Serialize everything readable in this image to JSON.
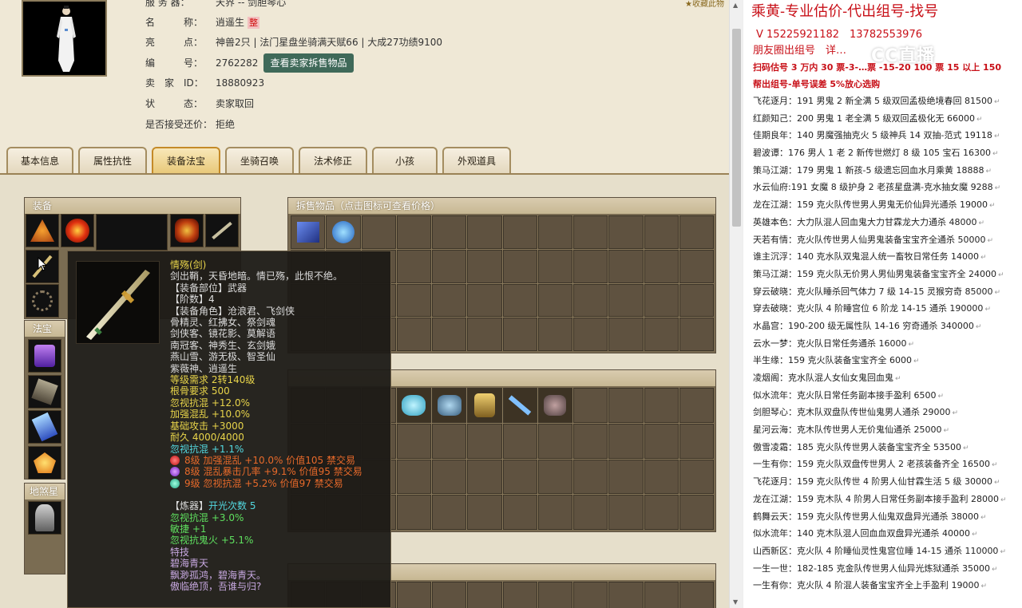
{
  "info": {
    "server_label": "服 务 器：",
    "server_value": "天界 -- 剑胆琴心",
    "name_label": "名　　　称：",
    "name_value": "逍遥生",
    "name_badge": "整",
    "highlight_label": "亮　　　点：",
    "highlight_value": "神兽2只 | 法门星盘坐骑满天赋66 | 大成27功绩9100",
    "id_label": "编　　　号：",
    "id_value": "2762282",
    "view_items_button": "查看卖家拆售物品",
    "seller_label": "卖　家　ID：",
    "seller_value": "18880923",
    "status_label": "状　　　态：",
    "status_value": "卖家取回",
    "bargain_label": "是否接受还价：",
    "bargain_value": "拒绝",
    "favorite": "收藏此物"
  },
  "tabs": [
    {
      "label": "基本信息"
    },
    {
      "label": "属性抗性"
    },
    {
      "label": "装备法宝"
    },
    {
      "label": "坐骑召唤兽"
    },
    {
      "label": "法术修正"
    },
    {
      "label": "小孩"
    },
    {
      "label": "外观道具"
    }
  ],
  "active_tab": "装备法宝",
  "sections": {
    "equipment": "装备",
    "magic_treasure": "法宝",
    "earth_treasure": "地煞星",
    "sale_items": "拆售物品（点击图标可查看价格）"
  },
  "tooltip": {
    "name": "情殇(剑)",
    "desc": "剑出鞘，天昏地暗。情已殇，此恨不绝。",
    "part": "【装备部位】武器",
    "level": "【阶数】4",
    "roles_1": "【装备角色】沧浪君、飞剑侠",
    "roles_2": "骨精灵、红拂女、祭剑魂",
    "roles_3": "剑侠客、镜花影、莫解语",
    "roles_4": "南冠客、神秀生、玄剑娥",
    "roles_5": "燕山雪、游无极、智圣仙",
    "roles_6": "紫薇神、逍遥生",
    "req_level": "等级需求 2转140级",
    "req_bone": "根骨要求 500",
    "stat_1": "忽视抗混 +12.0%",
    "stat_2": "加强混乱 +10.0%",
    "stat_3": "基础攻击 +3000",
    "stat_4": "耐久 4000/4000",
    "stat_5": "忽视抗混 +1.1%",
    "gem_1": "8级 加强混乱 +10.0% 价值105 禁交易",
    "gem_2": "8级 混乱暴击几率 +9.1% 价值95 禁交易",
    "gem_3": "9级 忽视抗混 +5.2% 价值97 禁交易",
    "forge_title": "【炼器】",
    "forge_count": "开光次数 5",
    "forge_1": "忽视抗混 +3.0%",
    "forge_2": "敏捷 +1",
    "forge_3": "忽视抗鬼火 +5.1%",
    "skill_title": "特技",
    "skill_name": "碧海青天",
    "poem_1": "飘渺孤鸿，碧海青天。",
    "poem_2": "傲临绝顶，吾谁与归?"
  },
  "right": {
    "title": "乘黄-专业估价-代出组号-找号",
    "phone": "V 15225921182　13782553976",
    "friend": "朋友圈出组号　详…",
    "watermark": "CC直播",
    "note1": "扫码估号 3 万内 30 票-3-…票 -15-20 100 票 15 以上 150",
    "note2": "帮出组号-单号误差 5%放心选购",
    "items": [
      "飞花逐月：191 男鬼 2 新全满 5 级双回孟极绝境春回 81500",
      "红颜知己：200 男鬼 1 老全满 5 级双回孟极化无 66000",
      "佳期良年：140 男魔强抽克火 5 级神兵 14 双抽-范式 19118",
      "碧波谭：176 男人 1 老 2 新传世燃灯 8 级 105 宝石 16300",
      "策马江湖：179 男鬼 1 新孩-5 级遗忘回血水月乘黄 18888",
      "水云仙府:191 女魔 8 级护身 2 老孩星盘满-克水抽女魔 9288",
      "龙在江湖：159 克火队传世男人男鬼无价仙异光通杀 19000",
      "英雄本色：大力队混人回血鬼大力甘霖龙大力通杀 48000",
      "天若有情：克火队传世男人仙男鬼装备宝宝齐全通杀 50000",
      "谁主沉浮：140 克水队双鬼混人统一畜牧日常任务 14000",
      "策马江湖：159 克火队无价男人男仙男鬼装备宝宝齐全 24000",
      "穿云破晓：克火队睡杀回气体力 7 级 14-15 灵猴穷奇 85000",
      "穿去破晓：克火队 4 阶睡宫位 6 阶龙 14-15 通杀 190000",
      "水晶宫：190-200 级无属性队 14-16 穷奇通杀 340000",
      "云水一梦：克火队日常任务通杀 16000",
      "半生缘：159 克火队装备宝宝齐全 6000",
      "凌烟阁：克水队混人女仙女鬼回血鬼",
      "似水流年：克火队日常任务副本接手盈利 6500",
      "剑胆琴心：克木队双盘队传世仙鬼男人通杀 29000",
      "星河云海：克木队传世男人无价鬼仙通杀 25000",
      "傲雪凌霜：185 克火队传世男人装备宝宝齐全 53500",
      "一生有你：159 克火队双盘传世男人 2 老孩装备齐全 16500",
      "飞花逐月：159 克火队传世 4 阶男人仙甘霖生活 5 级 30000",
      "龙在江湖：159 克木队 4 阶男人日常任务副本接手盈利 28000",
      "鹤舞云天：159 克火队传世男人仙鬼双盘异光通杀 38000",
      "似水流年：140 克木队混人回血血双盘异光通杀 40000",
      "山西新区：克火队 4 阶睡仙灵性鬼宫位睡 14-15 通杀 110000",
      "一生一世：182-185 克金队传世男人仙异光炼狱通杀 35000",
      "一生有你：克火队 4 阶混人装备宝宝齐全上手盈利 19000"
    ]
  }
}
